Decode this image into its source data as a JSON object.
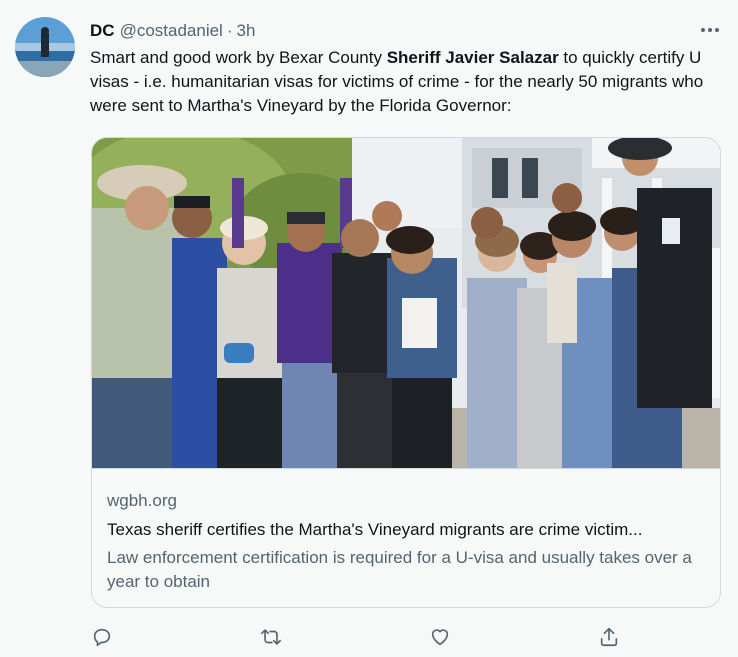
{
  "author": {
    "name": "DC",
    "handle": "@costadaniel",
    "separator": "·",
    "time": "3h"
  },
  "tweet": {
    "text_before": "Smart and good work by Bexar County ",
    "text_bold": "Sheriff Javier Salazar",
    "text_after": " to quickly certify U visas - i.e. humanitarian visas for victims of crime - for the nearly 50 migrants who were sent to Martha's Vineyard by the Florida Governor:"
  },
  "card": {
    "domain": "wgbh.org",
    "title": "Texas sheriff certifies the Martha's Vineyard migrants are crime victim...",
    "description": "Law enforcement certification is required for a U-visa and usually takes over a year to obtain"
  },
  "icons": {
    "more": "more-icon",
    "reply": "reply-icon",
    "retweet": "retweet-icon",
    "like": "like-icon",
    "share": "share-icon"
  },
  "colors": {
    "secondary_text": "#536471",
    "border": "#cfd9de",
    "background": "#f7f9f9"
  }
}
